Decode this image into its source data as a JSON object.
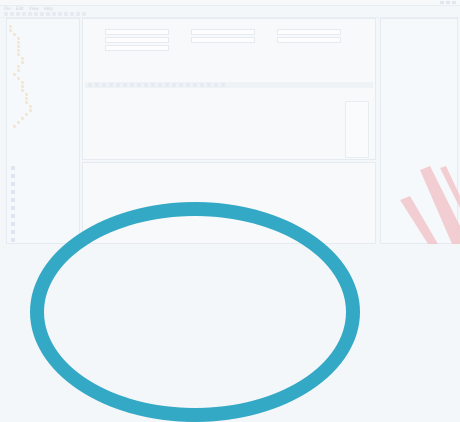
{
  "window": {
    "title": ""
  },
  "menu": [
    "File",
    "Edit",
    "View",
    "Help"
  ],
  "left_panel": {
    "tree": [
      "",
      "",
      "",
      "",
      "",
      "",
      "",
      "",
      "",
      "",
      "",
      "",
      "",
      "",
      "",
      "",
      "",
      "",
      "",
      "",
      "",
      "",
      "",
      "",
      "",
      ""
    ],
    "lower": [
      "",
      "",
      "",
      "",
      "",
      "",
      "",
      "",
      "",
      ""
    ]
  },
  "center": {
    "doc_title": "",
    "fields": [
      "",
      "",
      "",
      "",
      "",
      "",
      ""
    ],
    "columns": [
      "",
      "",
      "",
      "",
      "",
      "",
      "",
      ""
    ],
    "rows": [
      [
        "",
        "",
        "",
        "",
        "",
        "",
        "",
        ""
      ],
      [
        "",
        "",
        "",
        "",
        "",
        "",
        "",
        ""
      ],
      [
        "",
        "",
        "",
        "",
        "",
        "",
        "",
        ""
      ]
    ]
  },
  "bottom": {
    "tabs": [
      "",
      "",
      ""
    ],
    "rows": [
      [
        "",
        "",
        "",
        "",
        "",
        "",
        ""
      ],
      [
        "",
        "",
        "",
        "",
        "",
        "",
        ""
      ]
    ]
  },
  "right_panel": {
    "lines": [
      "",
      "",
      "",
      "",
      "",
      ""
    ]
  },
  "colors": {
    "teal_arc": "#34a9c6",
    "stripe": "#f2c4c8"
  }
}
